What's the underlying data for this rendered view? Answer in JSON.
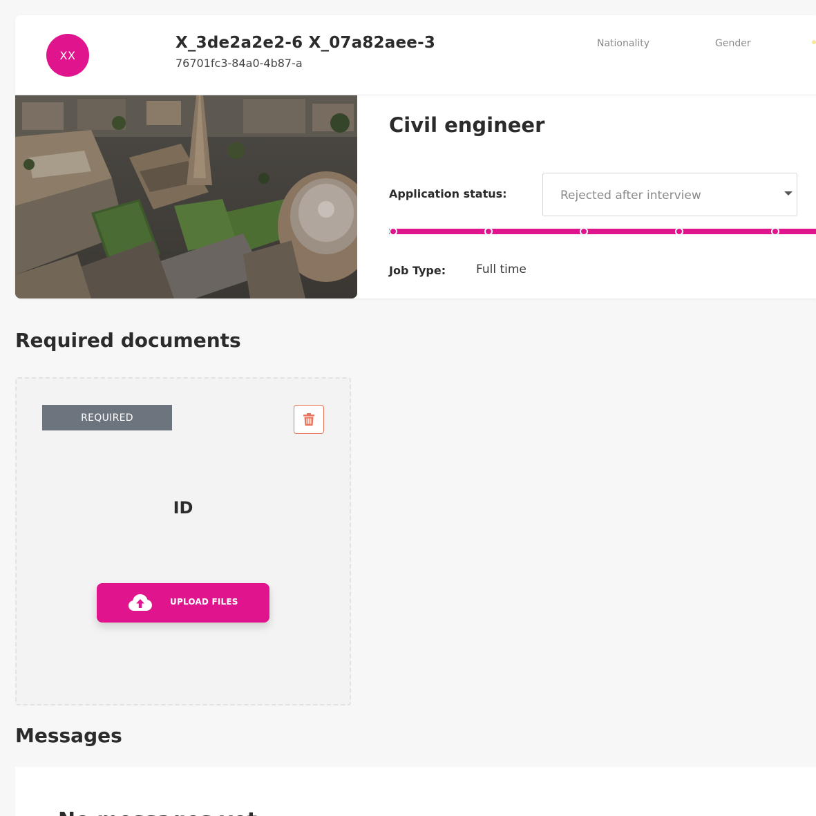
{
  "candidate": {
    "initials": "XX",
    "name": "X_3de2a2e2-6 X_07a82aee-3",
    "id": "76701fc3-84a0-4b87-a",
    "nationality_label": "Nationality",
    "gender_label": "Gender"
  },
  "job": {
    "title": "Civil engineer",
    "status_label": "Application status:",
    "status_value": "Rejected after interview",
    "progress_steps": 5,
    "job_type_label": "Job Type:",
    "job_type_value": "Full time"
  },
  "documents": {
    "section_title": "Required documents",
    "items": [
      {
        "badge": "REQUIRED",
        "name": "ID",
        "upload_label": "UPLOAD FILES"
      }
    ]
  },
  "messages": {
    "section_title": "Messages",
    "empty_text": "No messages yet"
  },
  "colors": {
    "accent": "#e0158d",
    "badge": "#6c757d",
    "danger": "#e8735a"
  },
  "icons": {
    "delete": "trash-icon",
    "upload": "cloud-upload-icon",
    "dropdown": "caret-down-icon"
  }
}
